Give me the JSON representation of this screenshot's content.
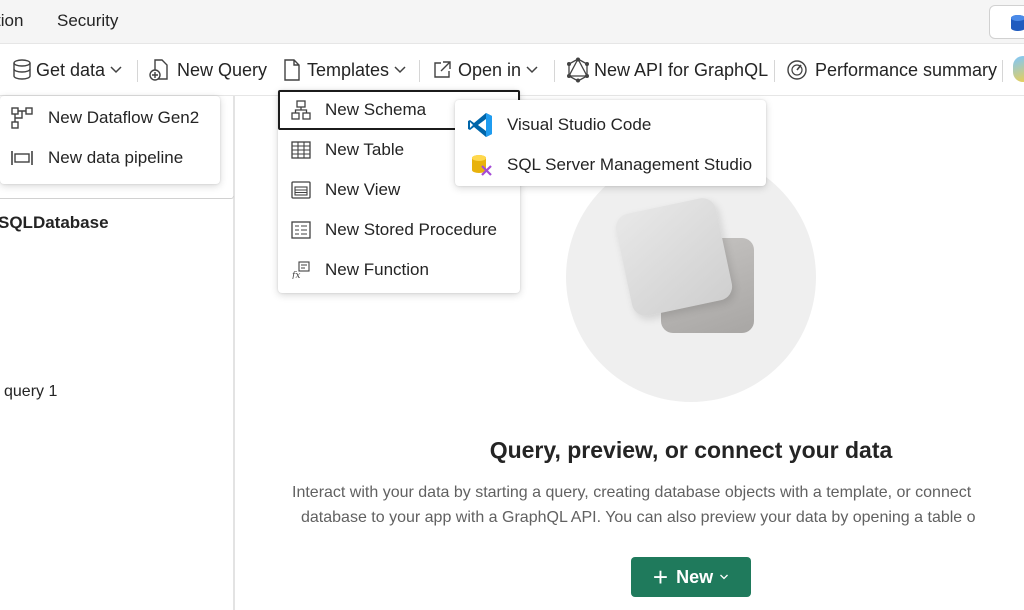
{
  "tabs": {
    "partial_tab": "tion",
    "security": "Security"
  },
  "toolbar": {
    "get_data": "Get data",
    "new_query": "New Query",
    "templates": "Templates",
    "open_in": "Open in",
    "new_graphql": "New API for GraphQL",
    "performance": "Performance summary"
  },
  "get_data_menu": {
    "items": [
      "New Dataflow Gen2",
      "New data pipeline"
    ]
  },
  "templates_menu": {
    "items": [
      "New Schema",
      "New Table",
      "New View",
      "New Stored Procedure",
      "New Function"
    ]
  },
  "open_in_menu": {
    "items": [
      "Visual Studio Code",
      "SQL Server Management Studio"
    ]
  },
  "explorer": {
    "title": "SQLDatabase",
    "query_item": "query 1"
  },
  "hero": {
    "title": "Query, preview, or connect your data",
    "desc_line1": "Interact with your data by starting a query, creating database objects with a template, or connect",
    "desc_line2": "database to your app with a GraphQL API. You can also preview your data by opening a table o",
    "button": "New"
  },
  "colors": {
    "primary_button": "#1f7a5c",
    "vscode_blue": "#0065a9",
    "ssms_yellow": "#f5c518"
  }
}
